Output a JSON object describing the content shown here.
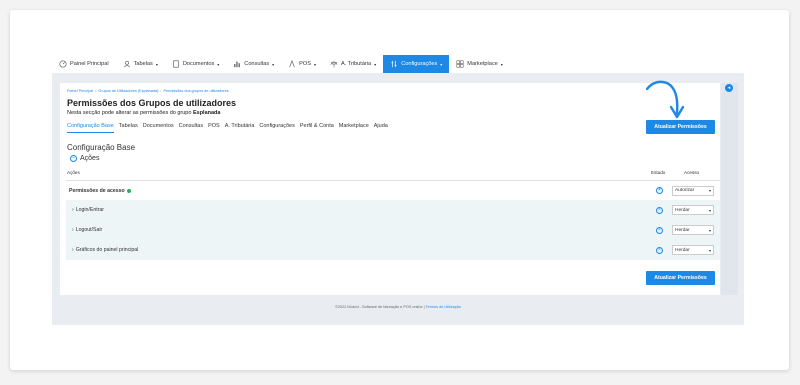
{
  "navbar": {
    "items": [
      {
        "label": "Painel Principal",
        "icon": "dashboard-icon",
        "has_menu": false
      },
      {
        "label": "Tabelas",
        "icon": "users-icon",
        "has_menu": true
      },
      {
        "label": "Documentos",
        "icon": "document-icon",
        "has_menu": true
      },
      {
        "label": "Consultas",
        "icon": "bar-chart-icon",
        "has_menu": true
      },
      {
        "label": "POS",
        "icon": "pos-icon",
        "has_menu": true
      },
      {
        "label": "A. Tributária",
        "icon": "scale-icon",
        "has_menu": true
      },
      {
        "label": "Configurações",
        "icon": "settings-icon",
        "has_menu": true,
        "active": true
      },
      {
        "label": "Marketplace",
        "icon": "grid-icon",
        "has_menu": true
      }
    ]
  },
  "breadcrumb": [
    "Painel Principal",
    "Grupos de Utilizadores (Esplanada)",
    "Permissões dos grupos de utilizadores"
  ],
  "page": {
    "title": "Permissões dos Grupos de utilizadores",
    "subtitle_prefix": "Nesta secção pode alterar as permissões do grupo",
    "subtitle_group": "Esplanada"
  },
  "tabs": [
    "Configuração Base",
    "Tabelas",
    "Documentos",
    "Consultas",
    "POS",
    "A. Tributária",
    "Configurações",
    "Perfil & Conta",
    "Marketplace",
    "Ajuda"
  ],
  "update_button_label": "Atualizar Permissões",
  "section": {
    "title": "Configuração Base",
    "toggle_label": "Ações"
  },
  "table": {
    "headers": {
      "acoes": "Ações",
      "estado": "Estado",
      "acesso": "Acesso"
    },
    "main_row": {
      "label": "Permissões de acesso",
      "access": "Autorizar"
    },
    "sub_rows": [
      {
        "label": "Login/Entrar",
        "access": "Herdar"
      },
      {
        "label": "Logout/Sair",
        "access": "Herdar"
      },
      {
        "label": "Gráficos do painel principal",
        "access": "Herdar"
      }
    ]
  },
  "footer": {
    "text": "©2022 Moloni - Software de faturação e POS online",
    "link": "Termos de Utilização"
  },
  "colors": {
    "accent": "#1e88e5",
    "ok": "#27ae60"
  }
}
